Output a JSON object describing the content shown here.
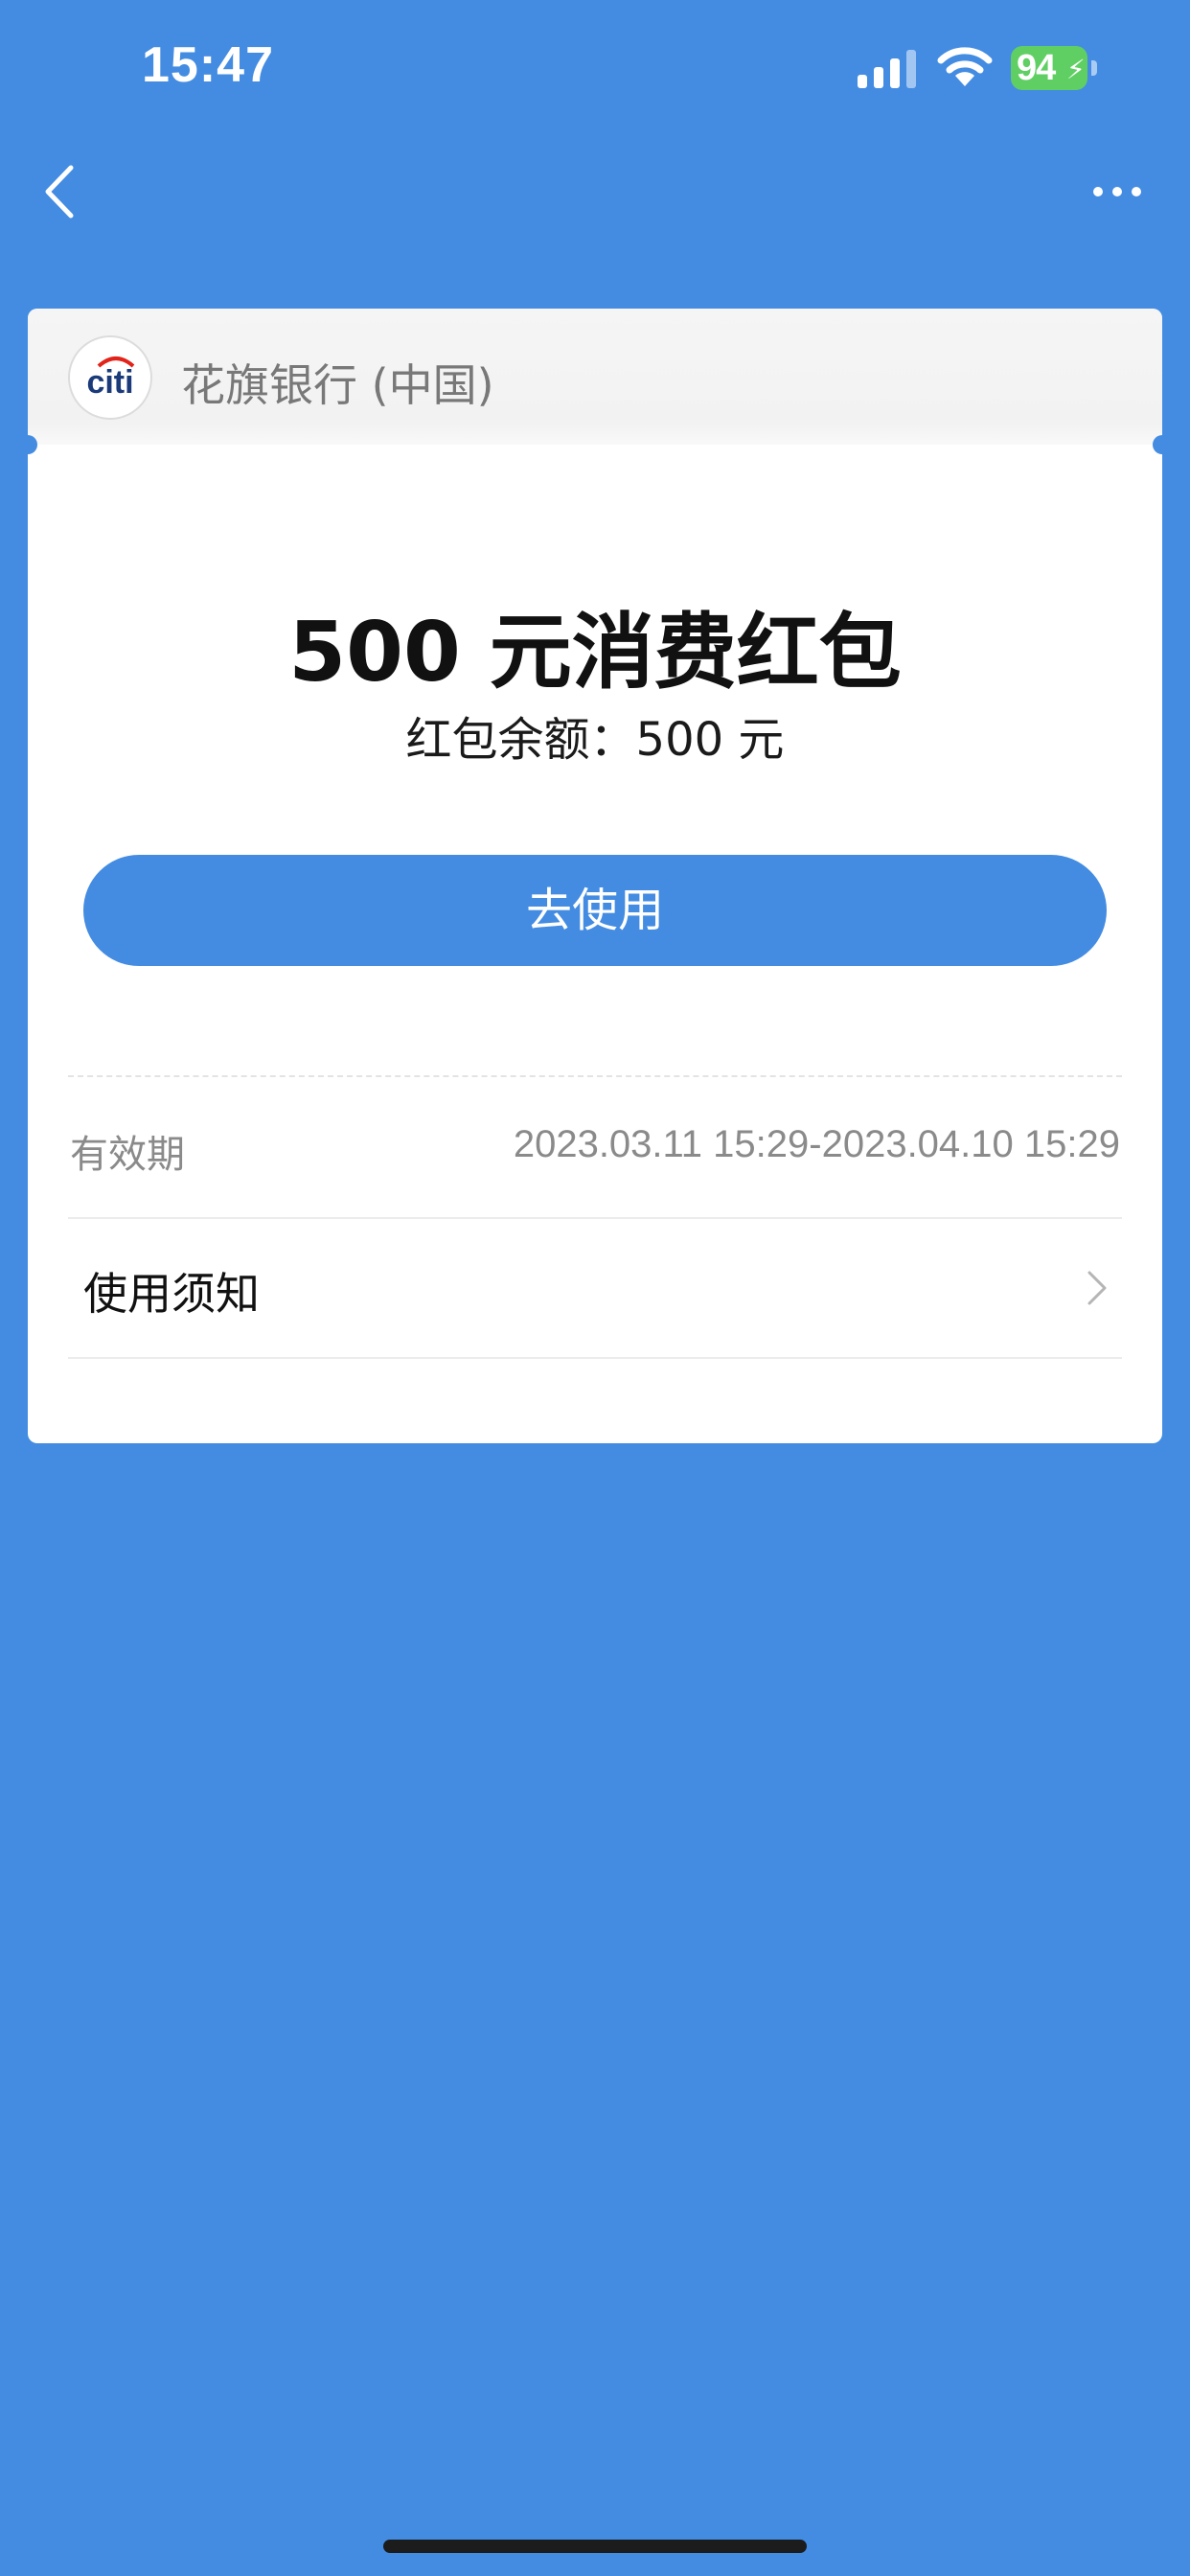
{
  "status_bar": {
    "time": "15:47",
    "battery": "94"
  },
  "nav": {
    "back_icon": "chevron-left-icon",
    "more_icon": "more-horizontal-icon"
  },
  "merchant": {
    "logo_text": "citi",
    "name": "花旗银行 (中国)"
  },
  "coupon": {
    "title": "500 元消费红包",
    "balance": "红包余额：500 元",
    "button_label": "去使用"
  },
  "details": {
    "validity_label": "有效期",
    "validity_value": "2023.03.11 15:29-2023.04.10 15:29",
    "usage_label": "使用须知"
  },
  "colors": {
    "background": "#438ce2",
    "card": "#ffffff",
    "battery": "#5fcf63"
  }
}
